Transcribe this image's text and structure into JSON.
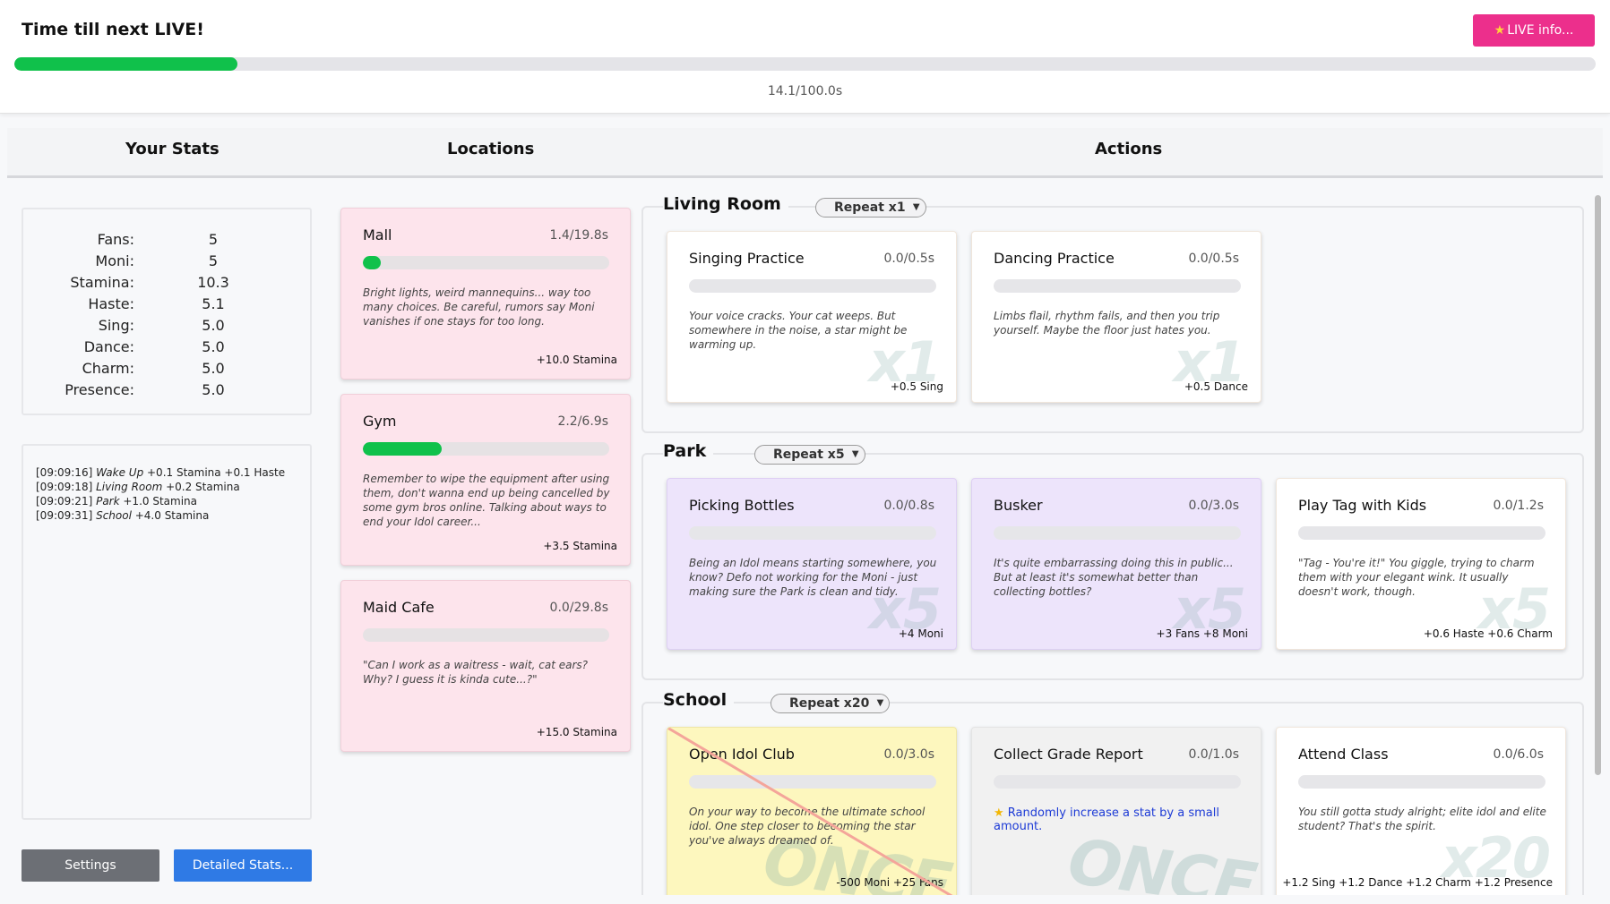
{
  "timer": {
    "title": "Time till next LIVE!",
    "live_button": "LIVE info...",
    "progress": 0.141,
    "time_text": "14.1/100.0s"
  },
  "headers": {
    "stats": "Your Stats",
    "locations": "Locations",
    "actions": "Actions"
  },
  "stats": [
    {
      "label": "Fans:",
      "value": "5"
    },
    {
      "label": "Moni:",
      "value": "5"
    },
    {
      "label": "Stamina:",
      "value": "10.3"
    },
    {
      "label": "Haste:",
      "value": "5.1"
    },
    {
      "label": "Sing:",
      "value": "5.0"
    },
    {
      "label": "Dance:",
      "value": "5.0"
    },
    {
      "label": "Charm:",
      "value": "5.0"
    },
    {
      "label": "Presence:",
      "value": "5.0"
    }
  ],
  "log": [
    {
      "time": "[09:09:16]",
      "source": "Wake Up",
      "text": "+0.1 Stamina +0.1 Haste"
    },
    {
      "time": "[09:09:18]",
      "source": "Living Room",
      "text": "+0.2 Stamina"
    },
    {
      "time": "[09:09:21]",
      "source": "Park",
      "text": "+1.0 Stamina"
    },
    {
      "time": "[09:09:31]",
      "source": "School",
      "text": "+4.0 Stamina"
    }
  ],
  "buttons": {
    "settings": "Settings",
    "detailed": "Detailed Stats..."
  },
  "locations": [
    {
      "name": "Mall",
      "time": "1.4/19.8s",
      "progress": 0.071,
      "desc": "Bright lights, weird mannequins... way too many choices. Be careful, rumors say Moni vanishes if one stays for too long.",
      "reward": "+10.0 Stamina"
    },
    {
      "name": "Gym",
      "time": "2.2/6.9s",
      "progress": 0.319,
      "desc": "Remember to wipe the equipment after using them, don't wanna end up being cancelled by some gym bros online. Talking about ways to end your Idol career...",
      "reward": "+3.5 Stamina"
    },
    {
      "name": "Maid Cafe",
      "time": "0.0/29.8s",
      "progress": 0,
      "desc": "\"Can I work as a waitress - wait, cat ears? Why? I guess it is kinda cute...?\"",
      "reward": "+15.0 Stamina"
    }
  ],
  "groups": [
    {
      "name": "Living Room",
      "repeat": "Repeat x1",
      "actions": [
        {
          "name": "Singing Practice",
          "time": "0.0/0.5s",
          "desc": "Your voice cracks. Your cat weeps. But somewhere in the noise, a star might be warming up.",
          "reward": "+0.5 Sing",
          "mark": "x1"
        },
        {
          "name": "Dancing Practice",
          "time": "0.0/0.5s",
          "desc": "Limbs flail, rhythm fails, and then you trip yourself. Maybe the floor just hates you.",
          "reward": "+0.5 Dance",
          "mark": "x1"
        }
      ]
    },
    {
      "name": "Park",
      "repeat": "Repeat x5",
      "actions": [
        {
          "name": "Picking Bottles",
          "time": "0.0/0.8s",
          "desc": "Being an Idol means starting somewhere, you know? Defo not working for the Moni - just making sure the Park is clean and tidy.",
          "reward": "+4 Moni",
          "mark": "x5"
        },
        {
          "name": "Busker",
          "time": "0.0/3.0s",
          "desc": "It's quite embarrassing doing this in public... But at least it's somewhat better than collecting bottles?",
          "reward": "+3 Fans +8 Moni",
          "mark": "x5"
        },
        {
          "name": "Play Tag with Kids",
          "time": "0.0/1.2s",
          "desc": "\"Tag - You're it!\" You giggle, trying to charm them with your elegant wink. It usually doesn't work, though.",
          "reward": "+0.6 Haste +0.6 Charm",
          "mark": "x5"
        }
      ]
    },
    {
      "name": "School",
      "repeat": "Repeat x20",
      "actions": [
        {
          "name": "Open Idol Club",
          "time": "0.0/3.0s",
          "desc": "On your way to become the ultimate school idol. One step closer to becoming the star you've always dreamed of.",
          "reward": "-500 Moni +25 Fans",
          "mark": "ONCE"
        },
        {
          "name": "Collect Grade Report",
          "time": "0.0/1.0s",
          "desc": "Randomly increase a stat by a small amount.",
          "reward": "",
          "mark": "ONCE"
        },
        {
          "name": "Attend Class",
          "time": "0.0/6.0s",
          "desc": "You still gotta study alright; elite idol and elite student? That's the spirit.",
          "reward": "+1.2 Sing +1.2 Dance +1.2 Charm +1.2 Presence",
          "mark": "x20"
        }
      ]
    }
  ],
  "colors": {
    "accent_pink": "#ec2f8c",
    "progress_green": "#10c14b",
    "location_card": "#fde4ec",
    "park_card": "#ede4fb",
    "club_card": "#fdf7be",
    "link_blue": "#1c3ad6"
  },
  "icons": {
    "live_button": "star-icon",
    "grade_report": "star-icon",
    "select_chevron": "chevron-down-icon"
  }
}
